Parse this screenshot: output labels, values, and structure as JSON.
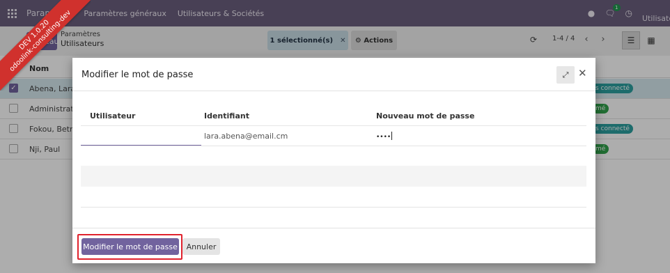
{
  "navbar": {
    "brand": "Paramètres",
    "menu": [
      "Paramètres généraux",
      "Utilisateurs & Sociétés"
    ],
    "messages_badge": "1",
    "user_label": "Utilisateur"
  },
  "control_panel": {
    "new_button": "Nouveau",
    "breadcrumb_parent": "Paramètres",
    "breadcrumb_current": "Utilisateurs",
    "selection": "1 sélectionné(s)",
    "actions": "Actions",
    "pager": "1-4 / 4"
  },
  "list": {
    "column_name": "Nom",
    "rows": [
      {
        "name": "Abena, Lara",
        "checked": true,
        "tag": "s connecté"
      },
      {
        "name": "Administrato",
        "checked": false,
        "tag": "mé"
      },
      {
        "name": "Fokou, Betra",
        "checked": false,
        "tag": "s connecté"
      },
      {
        "name": "Nji, Paul",
        "checked": false,
        "tag": "mé"
      }
    ]
  },
  "dialog": {
    "title": "Modifier le mot de passe",
    "columns": {
      "user": "Utilisateur",
      "login": "Identifiant",
      "new_password": "Nouveau mot de passe"
    },
    "row": {
      "user": "",
      "login": "lara.abena@email.cm",
      "new_password": "••••"
    },
    "confirm_button": "Modifier le mot de passe",
    "cancel_button": "Annuler"
  },
  "ribbon": {
    "line1": "DEV 1.0.20",
    "line2": "odoolink-consulting-dev"
  },
  "colors": {
    "navbar": "#6b5f7e",
    "primary": "#71639e",
    "highlight_border": "#e0222d",
    "ribbon": "#d0312d"
  }
}
